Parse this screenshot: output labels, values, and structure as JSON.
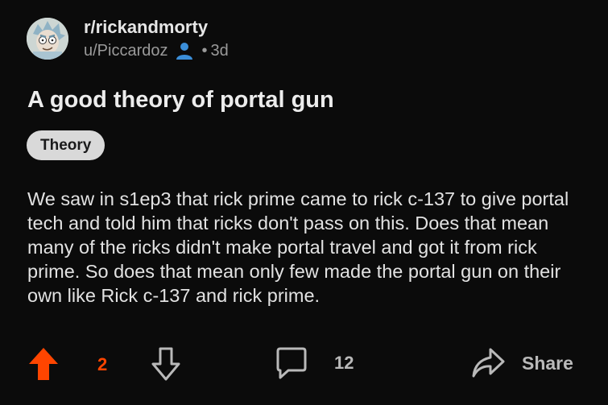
{
  "post": {
    "subreddit": "r/rickandmorty",
    "author": "u/Piccardoz",
    "separator": "•",
    "age": "3d",
    "title": "A good theory of portal gun",
    "flair": "Theory",
    "body": "We saw in s1ep3 that rick prime came to rick c-137 to give portal tech and told him that ricks don't pass on this. Does that mean many of the ricks didn't make portal travel and got it from rick prime. So does that mean only few made the portal gun on their own like Rick c-137 and rick prime."
  },
  "actions": {
    "vote_count": "2",
    "comment_count": "12",
    "share_label": "Share"
  },
  "colors": {
    "background": "#0b0b0b",
    "upvote_active": "#ff4500",
    "user_icon": "#3b8ed8",
    "flair_bg": "#d9d9d9",
    "muted_text": "#9a9a9a"
  },
  "icons": {
    "avatar": "subreddit-avatar",
    "user": "user-icon",
    "upvote": "upvote-arrow-icon",
    "downvote": "downvote-arrow-icon",
    "comment": "comment-bubble-icon",
    "share": "share-arrow-icon"
  }
}
